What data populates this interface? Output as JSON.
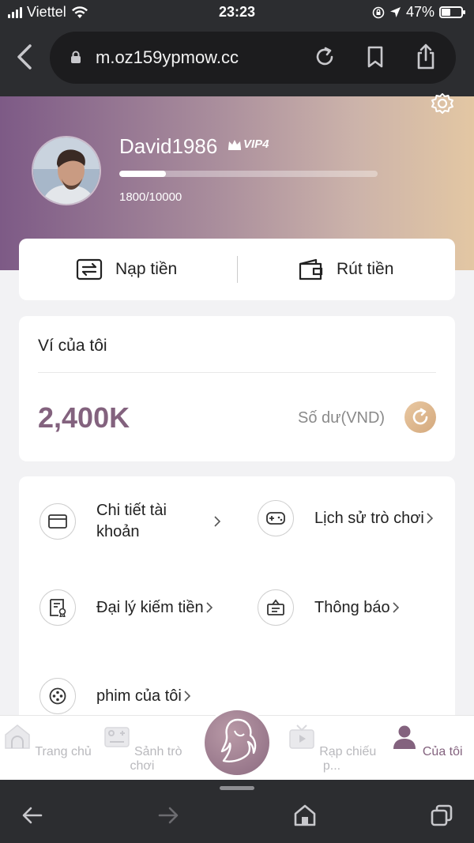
{
  "status": {
    "carrier": "Viettel",
    "time": "23:23",
    "battery": "47%",
    "battery_level": 0.47
  },
  "browser": {
    "url": "m.oz159ypmow.cc"
  },
  "profile": {
    "username": "David1986",
    "vip": "VIP4",
    "exp": "1800/10000",
    "exp_current": 1800,
    "exp_max": 10000
  },
  "actions": {
    "deposit": "Nạp tiền",
    "withdraw": "Rút tiền"
  },
  "wallet": {
    "title": "Ví của tôi",
    "balance": "2,400K",
    "balance_label": "Số dư(VND)"
  },
  "menu": {
    "account_details": "Chi tiết tài khoản",
    "game_history": "Lịch sử trò chơi",
    "agent": "Đại lý kiếm tiền",
    "notifications": "Thông báo",
    "my_movies": "phim của tôi"
  },
  "tabs": {
    "home": "Trang chủ",
    "game_lobby": "Sảnh trò chơi",
    "cinema": "Rạp chiếu p...",
    "mine": "Của tôi"
  },
  "colors": {
    "accent": "#83627e",
    "gradient_start": "#7d5a86",
    "gradient_end": "#e3c7a3",
    "gold": "#d4a97d"
  }
}
